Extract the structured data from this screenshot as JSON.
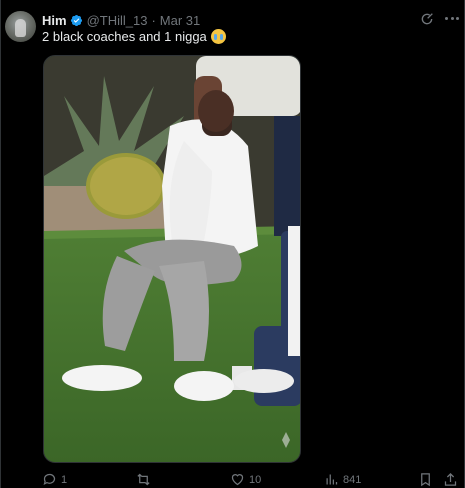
{
  "tweet": {
    "author_name": "Him",
    "handle": "@THill_13",
    "separator": "·",
    "date": "Mar 31",
    "text": "2 black coaches and 1 nigga",
    "emoji": "loudly-crying-face-emoji"
  },
  "icons": {
    "verified": "verified-badge-icon",
    "grok": "grok-icon",
    "more": "more-icon",
    "reply": "reply-icon",
    "retweet": "retweet-icon",
    "like": "like-icon",
    "views": "views-icon",
    "bookmark": "bookmark-icon",
    "share": "share-icon"
  },
  "stats": {
    "replies": "1",
    "retweets": "",
    "likes": "10",
    "views": "841"
  },
  "colors": {
    "background": "#000000",
    "text": "#e7e9ea",
    "muted": "#71767b",
    "verified": "#1d9bf0",
    "border": "#2f3336"
  }
}
